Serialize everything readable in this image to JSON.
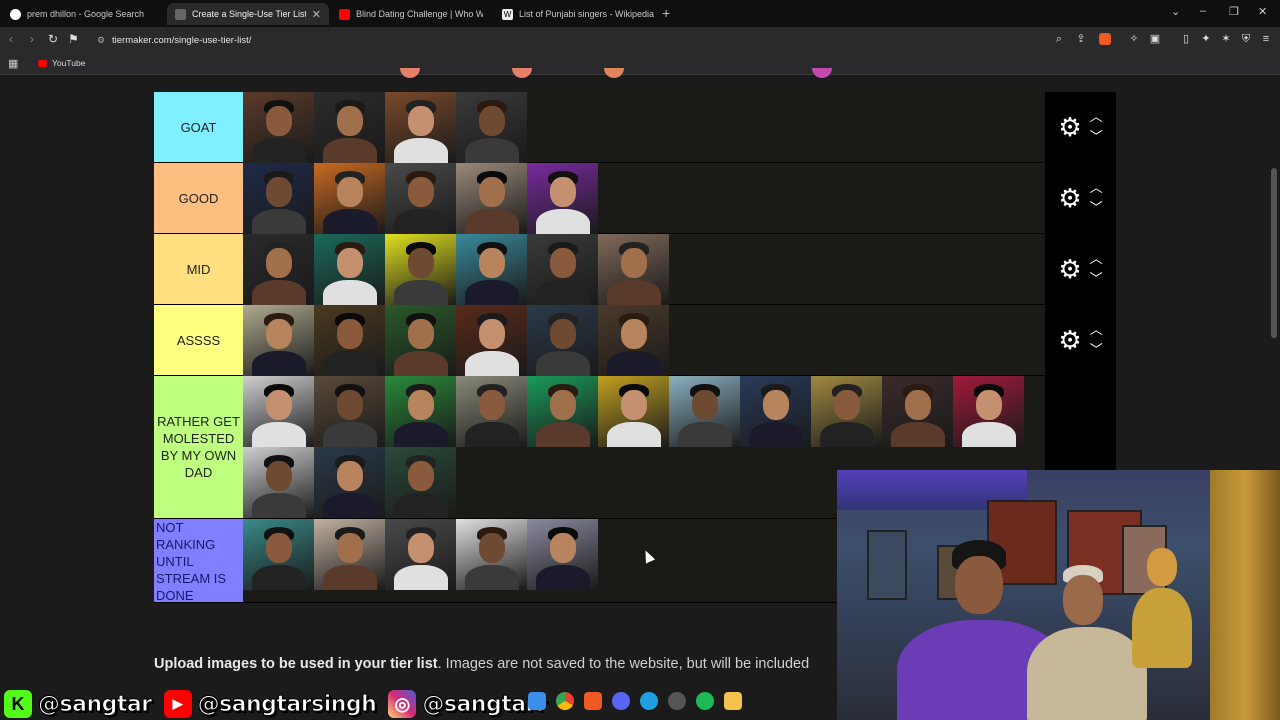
{
  "browser": {
    "tabs": [
      {
        "title": "prem dhillon - Google Search",
        "color": "#4285f4",
        "active": false
      },
      {
        "title": "Create a Single-Use Tier List (Pri…",
        "color": "#3a3a3a",
        "active": true
      },
      {
        "title": "Blind Dating Challenge | Who Will Ki…",
        "color": "#ff0000",
        "active": false
      },
      {
        "title": "List of Punjabi singers - Wikipedia",
        "color": "#ffffff",
        "active": false
      }
    ],
    "url": "tiermaker.com/single-use-tier-list/",
    "bookmark_youtube": "YouTube"
  },
  "tiers": [
    {
      "label": "GOAT",
      "color": "#7ff0ff",
      "item_count": 4
    },
    {
      "label": "GOOD",
      "color": "#ffbf80",
      "item_count": 5
    },
    {
      "label": "MID",
      "color": "#ffdf80",
      "item_count": 6
    },
    {
      "label": "ASSSS",
      "color": "#ffff80",
      "item_count": 6
    },
    {
      "label": "RATHER GET MOLESTED BY MY OWN DAD",
      "color": "#bfff80",
      "item_count": 14
    },
    {
      "label": "NOT RANKING UNTIL STREAM IS DONE",
      "color": "#7f7fff",
      "item_count": 5
    }
  ],
  "upload_text_bold": "Upload images to be used in your tier list",
  "upload_text_rest": ". Images are not saved to the website, but will be included",
  "socials": [
    {
      "icon": "kick-icon",
      "glyph": "K",
      "color": "#53fc18",
      "handle": "@sangtar"
    },
    {
      "icon": "youtube-icon",
      "glyph": "▶",
      "color": "#ff0000",
      "handle": "@sangtarsingh"
    },
    {
      "icon": "instagram-icon",
      "glyph": "◎",
      "color": "#d62976",
      "handle": "@sangtarr"
    }
  ]
}
